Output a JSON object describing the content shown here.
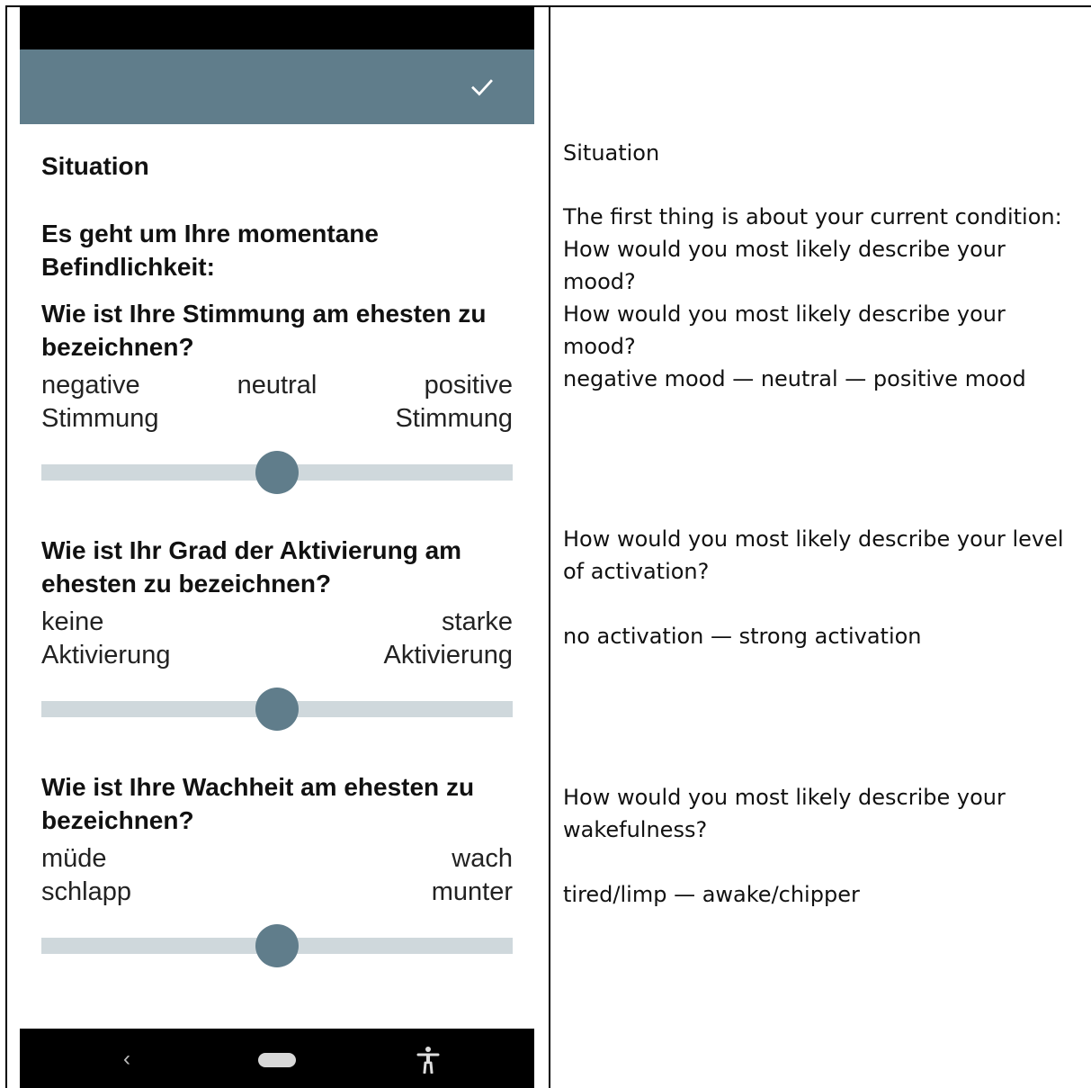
{
  "colors": {
    "app_bar": "#607d8b",
    "track": "#cfd8dc",
    "thumb": "#607d8b"
  },
  "app_bar": {
    "action_icon": "check-icon"
  },
  "form": {
    "heading": "Situation",
    "intro_line1": "Es geht um Ihre momentane",
    "intro_line2": "Befindlichkeit:",
    "questions": [
      {
        "line1": "Wie ist Ihre Stimmung am ehesten zu",
        "line2": "bezeichnen?",
        "left_line1": "negative",
        "left_line2": "Stimmung",
        "center": "neutral",
        "right_line1": "positive",
        "right_line2": "Stimmung",
        "value": 0.5
      },
      {
        "line1": "Wie ist Ihr Grad der Aktivierung am",
        "line2": "ehesten zu bezeichnen?",
        "left_line1": "keine",
        "left_line2": "Aktivierung",
        "right_line1": "starke",
        "right_line2": "Aktivierung",
        "value": 0.5
      },
      {
        "line1": "Wie ist Ihre Wachheit am ehesten zu",
        "line2": "bezeichnen?",
        "left_line1": "müde",
        "left_line2": "schlapp",
        "right_line1": "wach",
        "right_line2": "munter",
        "value": 0.5
      }
    ]
  },
  "nav_bar": {
    "back_icon": "chevron-left-icon",
    "home_icon": "home-pill-icon",
    "accessibility_icon": "accessibility-icon"
  },
  "translation": {
    "heading": "Situation",
    "intro_line1": "The first thing is about your current condition:",
    "q1_line1": "How would you most likely describe your",
    "q1_line2": "mood?",
    "q1_repeat_line1": "How would you most likely describe your",
    "q1_repeat_line2": "mood?",
    "q1_scale": "negative mood — neutral — positive mood",
    "q2_line1": "How would you most likely describe your level",
    "q2_line2": "of activation?",
    "q2_scale": "no activation — strong activation",
    "q3_line1": "How would you most likely describe your",
    "q3_line2": "wakefulness?",
    "q3_scale": "tired/limp — awake/chipper"
  }
}
